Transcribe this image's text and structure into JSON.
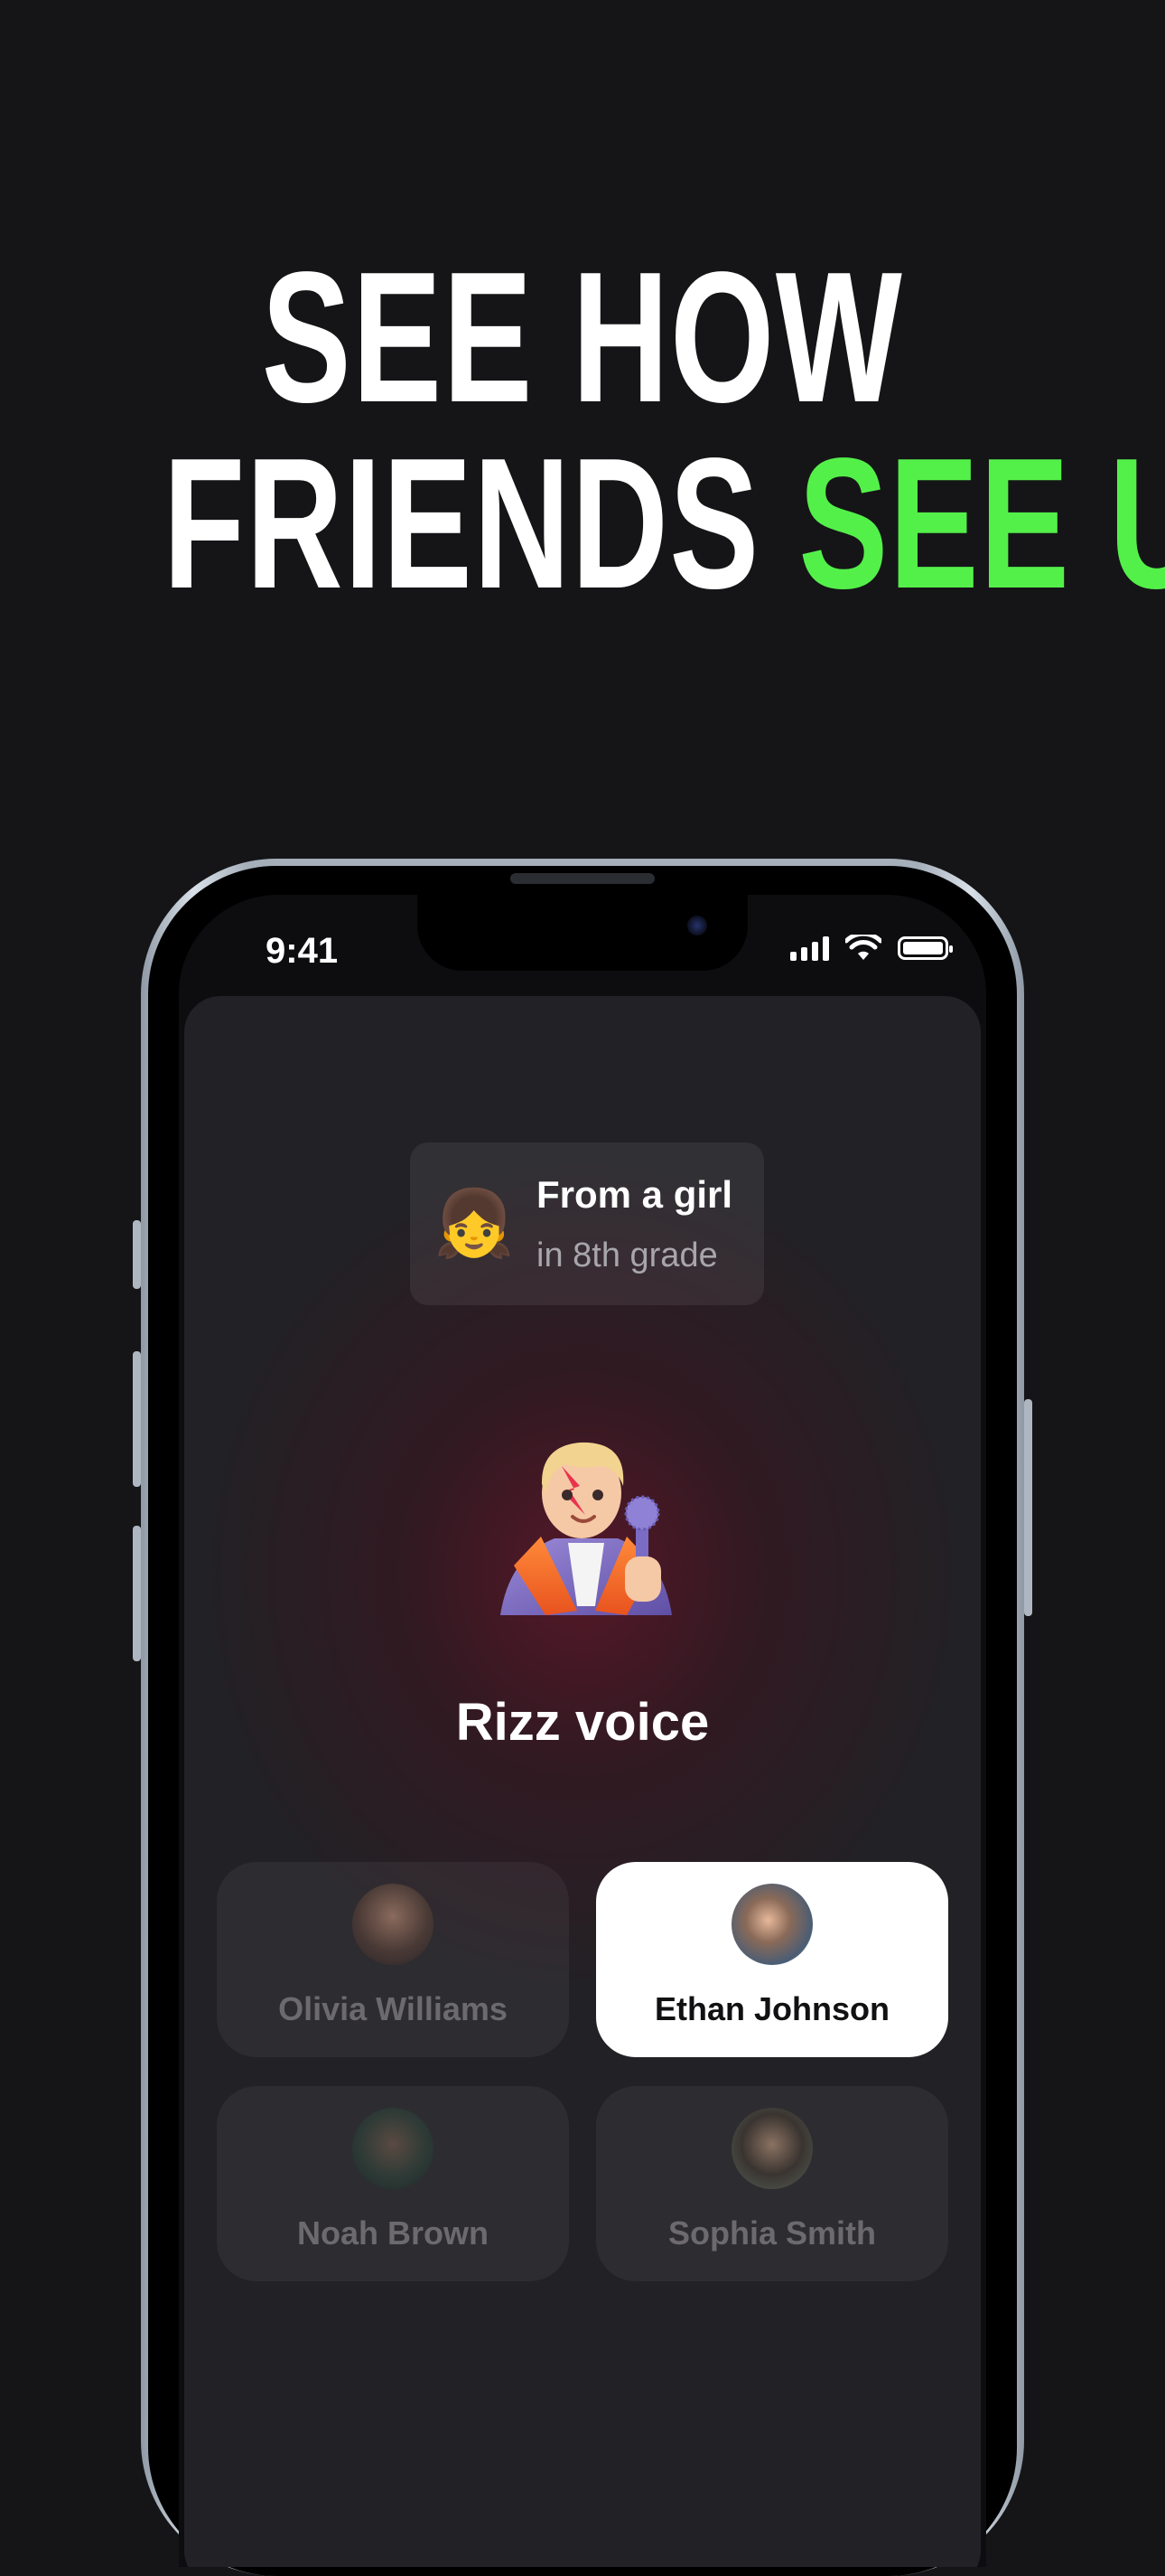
{
  "headline": {
    "line1": "SEE HOW",
    "line2_white": "FRIENDS",
    "line2_green": "SEE U",
    "accent_color": "#54f04a"
  },
  "status_bar": {
    "time": "9:41",
    "icons": [
      "cellular-signal-icon",
      "wifi-icon",
      "battery-icon"
    ]
  },
  "sender": {
    "emoji": "👧",
    "title": "From a girl",
    "subtitle": "in 8th grade"
  },
  "prompt": {
    "emoji_name": "singer-emoji",
    "label": "Rizz voice"
  },
  "options": [
    {
      "name": "Olivia Williams",
      "selected": false
    },
    {
      "name": "Ethan Johnson",
      "selected": true
    },
    {
      "name": "Noah Brown",
      "selected": false
    },
    {
      "name": "Sophia Smith",
      "selected": false
    }
  ]
}
